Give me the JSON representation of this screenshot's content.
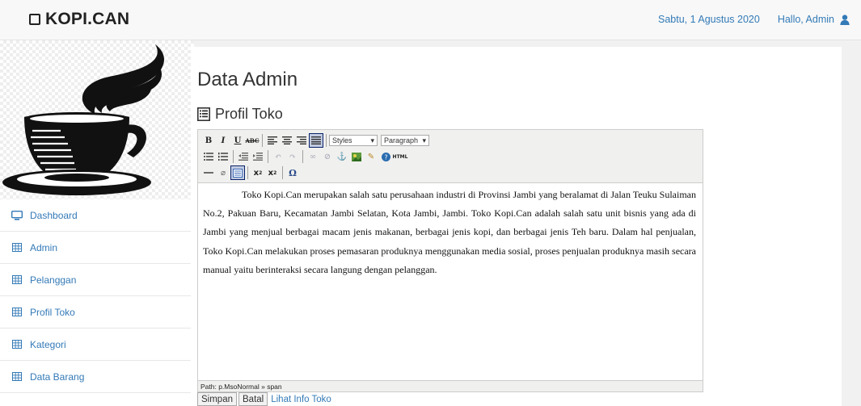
{
  "navbar": {
    "brand": "KOPI.CAN",
    "date": "Sabtu, 1 Agustus 2020",
    "greeting": "Hallo, Admin"
  },
  "sidebar": {
    "items": [
      {
        "label": "Dashboard",
        "icon": "monitor-icon"
      },
      {
        "label": "Admin",
        "icon": "table-icon"
      },
      {
        "label": "Pelanggan",
        "icon": "table-icon"
      },
      {
        "label": "Profil Toko",
        "icon": "table-icon"
      },
      {
        "label": "Kategori",
        "icon": "table-icon"
      },
      {
        "label": "Data Barang",
        "icon": "table-icon"
      }
    ]
  },
  "main": {
    "title": "Data Admin",
    "subtitle": "Profil Toko",
    "editor": {
      "styles_select": "Styles",
      "format_select": "Paragraph",
      "content": "Toko Kopi.Can merupakan salah satu perusahaan industri di Provinsi Jambi yang beralamat di Jalan Teuku Sulaiman No.2, Pakuan Baru, Kecamatan Jambi Selatan, Kota Jambi, Jambi. Toko Kopi.Can adalah salah satu unit bisnis yang ada di Jambi yang menjual berbagai macam jenis makanan, berbagai jenis kopi, dan berbagai jenis Teh baru. Dalam hal penjualan, Toko Kopi.Can melakukan proses pemasaran produknya menggunakan media sosial, proses penjualan produknya masih secara manual yaitu berinteraksi secara langung dengan pelanggan.",
      "path": "Path: p.MsoNormal » span"
    },
    "actions": {
      "save": "Simpan",
      "cancel": "Batal",
      "view": "Lihat Info Toko"
    }
  },
  "colors": {
    "link": "#337ab7",
    "navbar_bg": "#f8f8f8"
  }
}
